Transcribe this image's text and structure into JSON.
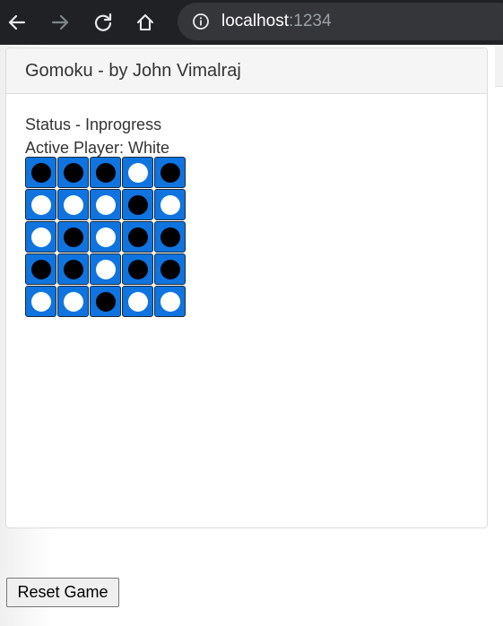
{
  "browser": {
    "url_host": "localhost",
    "url_port": ":1234",
    "icons": [
      "back-arrow-icon",
      "forward-arrow-icon",
      "reload-icon",
      "home-icon",
      "info-icon"
    ]
  },
  "panel": {
    "title": "Gomoku - by John Vimalraj"
  },
  "game": {
    "status": "Status - Inprogress",
    "active_player": "Active Player: White",
    "board": [
      [
        "black",
        "black",
        "black",
        "white",
        "black"
      ],
      [
        "white",
        "white",
        "white",
        "black",
        "white"
      ],
      [
        "white",
        "black",
        "white",
        "black",
        "black"
      ],
      [
        "black",
        "black",
        "white",
        "black",
        "black"
      ],
      [
        "white",
        "white",
        "black",
        "white",
        "white"
      ]
    ],
    "colors": {
      "cell": "#0f74df",
      "black_stone": "#000000",
      "white_stone": "#ffffff"
    }
  },
  "reset_button": {
    "label": "Reset Game"
  }
}
